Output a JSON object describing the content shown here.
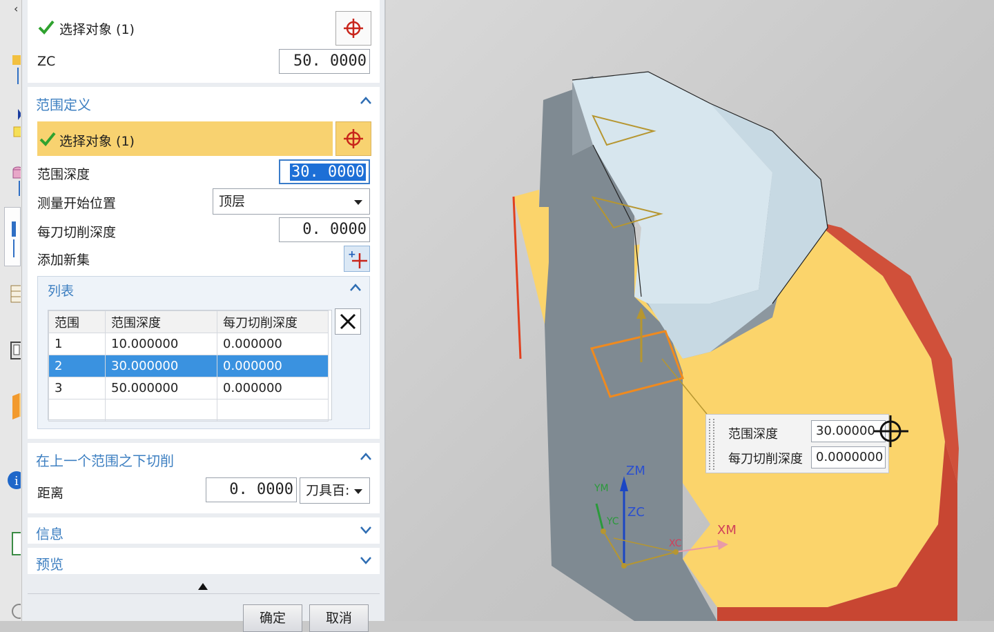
{
  "dialog": {
    "top_section": {
      "select_label": "选择对象 (1)",
      "zc_label": "ZC",
      "zc_value": "50. 0000"
    },
    "range_definition": {
      "title": "范围定义",
      "select_label": "选择对象 (1)",
      "depth_label": "范围深度",
      "depth_value": "30. 0000",
      "measure_start_label": "测量开始位置",
      "measure_start_value": "顶层",
      "per_cut_label": "每刀切削深度",
      "per_cut_value": "0. 0000",
      "add_set_label": "添加新集",
      "list": {
        "title": "列表",
        "columns": [
          "范围",
          "范围深度",
          "每刀切削深度"
        ],
        "rows": [
          {
            "range": "1",
            "depth": "10.000000",
            "per_cut": "0.000000"
          },
          {
            "range": "2",
            "depth": "30.000000",
            "per_cut": "0.000000"
          },
          {
            "range": "3",
            "depth": "50.000000",
            "per_cut": "0.000000"
          }
        ]
      }
    },
    "cut_below": {
      "title": "在上一个范围之下切削",
      "distance_label": "距离",
      "distance_value": "0. 0000",
      "unit_value": "刀具百:"
    },
    "info_title": "信息",
    "preview_title": "预览",
    "ok_label": "确定",
    "cancel_label": "取消"
  },
  "viewport": {
    "popup": {
      "depth_label": "范围深度",
      "depth_value": "30.00000",
      "per_cut_label": "每刀切削深度",
      "per_cut_value": "0.0000000"
    },
    "axes": {
      "zm": "ZM",
      "zc": "ZC",
      "xm": "XM",
      "xc": "XC",
      "ym": "YM",
      "yc": "YC"
    }
  },
  "colors": {
    "accent": "#3d7fc1",
    "highlight": "#f8d270",
    "selected_row": "#3a92e0",
    "part_face": "#d7e6ee",
    "part_side": "#7f8a92",
    "floor_face": "#fbd46b",
    "floor_side": "#c84632"
  },
  "icons": [
    "check-icon",
    "crosshair-icon",
    "add-set-icon",
    "delete-icon",
    "chevron-up-icon",
    "chevron-down-icon",
    "dropdown-arrow-icon"
  ]
}
